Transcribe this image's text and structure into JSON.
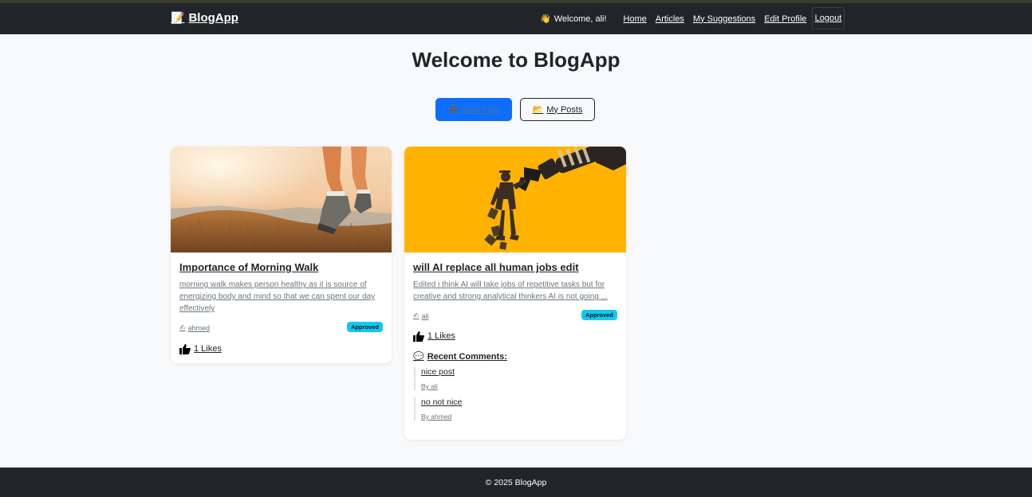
{
  "navbar": {
    "brand_icon": "memo-icon",
    "brand_emoji": "📝",
    "brand_label": "BlogApp",
    "welcome_emoji": "👋",
    "welcome_text": "Welcome, ali!",
    "links": [
      "Home",
      "Articles",
      "My Suggestions",
      "Edit Profile"
    ],
    "logout_label": "Logout"
  },
  "main": {
    "title": "Welcome to BlogApp",
    "new_post": {
      "emoji": "➕",
      "label": "New Post"
    },
    "my_posts": {
      "emoji": "📂",
      "label": "My Posts"
    }
  },
  "posts": [
    {
      "title": "Importance of Morning Walk",
      "excerpt": "morning walk makes person healthy as it is source of energizing body and mind so that we can spent our day effectively",
      "author_emoji": "✍",
      "author": "ahmed",
      "status": "Approved",
      "likes": "1 Likes",
      "image": "morning-walk-photo"
    },
    {
      "title": "will AI replace all human jobs edit",
      "excerpt": "Edited i think AI will take jobs of repetitive tasks but for creative and strong analytical thinkers AI is not going ...",
      "author_emoji": "✍",
      "author": "ali",
      "status": "Approved",
      "likes": "1 Likes",
      "image": "robot-arm-illustration",
      "comments_emoji": "💬",
      "comments_heading": "Recent Comments:",
      "comments": [
        {
          "text": "nice post",
          "by": "By ali"
        },
        {
          "text": "no not nice",
          "by": "By ahmed"
        }
      ]
    }
  ],
  "footer": {
    "text": "© 2025 BlogApp"
  },
  "colors": {
    "navbar": "#212529",
    "primary": "#0d6efd",
    "badge": "#0dcaf0",
    "page_bg": "#f8f9fa",
    "card_2_image_bg": "#ffb300"
  }
}
